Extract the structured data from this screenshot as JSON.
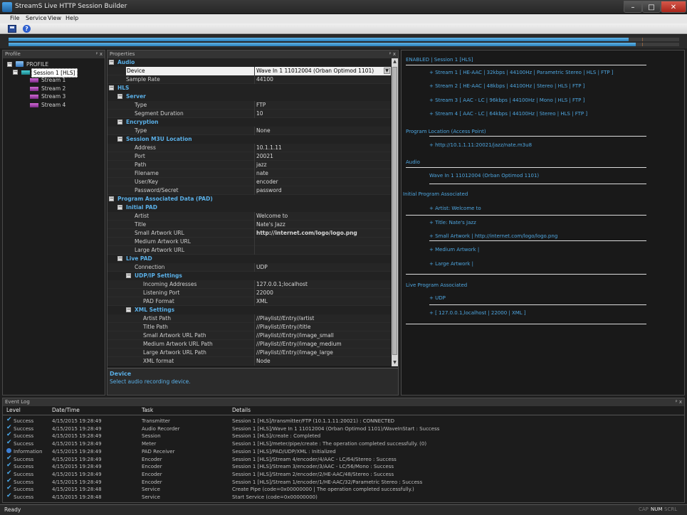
{
  "window": {
    "title": "StreamS Live HTTP Session Builder",
    "min": "–",
    "max": "□",
    "close": "✕"
  },
  "menu": [
    "File",
    "Service",
    "View",
    "Help"
  ],
  "toolbar": {
    "help": "?"
  },
  "meters": {
    "levels": [
      0.925,
      0.935
    ]
  },
  "profile": {
    "header": "Profile",
    "pins": "ᵖ x",
    "root": "PROFILE",
    "session": "Session 1 [HLS]",
    "streams": [
      "Stream 1",
      "Stream 2",
      "Stream 3",
      "Stream 4"
    ]
  },
  "properties": {
    "header": "Properties",
    "pins": "ᵖ x",
    "description_title": "Device",
    "description_text": "Select audio recording device.",
    "rows": [
      {
        "kind": "cat",
        "level": 0,
        "label": "Audio"
      },
      {
        "kind": "item",
        "level": 1,
        "label": "Device",
        "value": "Wave In 1 11012004 (Orban Optimod 1101)",
        "selected": true
      },
      {
        "kind": "item",
        "level": 1,
        "label": "Sample Rate",
        "value": "44100"
      },
      {
        "kind": "cat",
        "level": 0,
        "label": "HLS"
      },
      {
        "kind": "cat",
        "level": 1,
        "label": "Server"
      },
      {
        "kind": "item",
        "level": 2,
        "label": "Type",
        "value": "FTP"
      },
      {
        "kind": "item",
        "level": 2,
        "label": "Segment Duration",
        "value": "10"
      },
      {
        "kind": "cat",
        "level": 1,
        "label": "Encryption"
      },
      {
        "kind": "item",
        "level": 2,
        "label": "Type",
        "value": "None"
      },
      {
        "kind": "cat",
        "level": 1,
        "label": "Session M3U Location"
      },
      {
        "kind": "item",
        "level": 2,
        "label": "Address",
        "value": "10.1.1.11"
      },
      {
        "kind": "item",
        "level": 2,
        "label": "Port",
        "value": "20021"
      },
      {
        "kind": "item",
        "level": 2,
        "label": "Path",
        "value": "jazz"
      },
      {
        "kind": "item",
        "level": 2,
        "label": "Filename",
        "value": "nate"
      },
      {
        "kind": "item",
        "level": 2,
        "label": "User/Key",
        "value": "encoder"
      },
      {
        "kind": "item",
        "level": 2,
        "label": "Password/Secret",
        "value": "password"
      },
      {
        "kind": "cat",
        "level": 0,
        "label": "Program Associated Data (PAD)"
      },
      {
        "kind": "cat",
        "level": 1,
        "label": "Initial PAD"
      },
      {
        "kind": "item",
        "level": 2,
        "label": "Artist",
        "value": "Welcome to"
      },
      {
        "kind": "item",
        "level": 2,
        "label": "Title",
        "value": "Nate's Jazz"
      },
      {
        "kind": "item",
        "level": 2,
        "label": "Small Artwork URL",
        "value": "http://internet.com/logo/logo.png",
        "bold": true
      },
      {
        "kind": "item",
        "level": 2,
        "label": "Medium Artwork URL",
        "value": ""
      },
      {
        "kind": "item",
        "level": 2,
        "label": "Large Artwork URL",
        "value": ""
      },
      {
        "kind": "cat",
        "level": 1,
        "label": "Live PAD"
      },
      {
        "kind": "item",
        "level": 2,
        "label": "Connection",
        "value": "UDP"
      },
      {
        "kind": "cat",
        "level": 2,
        "label": "UDP/IP Settings"
      },
      {
        "kind": "item",
        "level": 3,
        "label": "Incoming Addresses",
        "value": "127.0.0.1;localhost"
      },
      {
        "kind": "item",
        "level": 3,
        "label": "Listening Port",
        "value": "22000"
      },
      {
        "kind": "item",
        "level": 3,
        "label": "PAD Format",
        "value": "XML"
      },
      {
        "kind": "cat",
        "level": 2,
        "label": "XML Settings"
      },
      {
        "kind": "item",
        "level": 3,
        "label": "Artist Path",
        "value": "//Playlist//Entry//artist"
      },
      {
        "kind": "item",
        "level": 3,
        "label": "Title Path",
        "value": "//Playlist//Entry//title"
      },
      {
        "kind": "item",
        "level": 3,
        "label": "Small Artwork URL Path",
        "value": "//Playlist//Entry//image_small"
      },
      {
        "kind": "item",
        "level": 3,
        "label": "Medium Artwork URL Path",
        "value": "//Playlist//Entry//image_medium"
      },
      {
        "kind": "item",
        "level": 3,
        "label": "Large Artwork URL Path",
        "value": "//Playlist//Entry//image_large"
      },
      {
        "kind": "item",
        "level": 3,
        "label": "XML format",
        "value": "Node"
      }
    ]
  },
  "summary": {
    "items": [
      {
        "text": "ENABLED | Session 1 [HLS]",
        "indent": 0
      },
      {
        "text": "+ Stream 1 [ HE-AAC | 32kbps | 44100Hz | Parametric Stereo | HLS | FTP ]",
        "indent": 1
      },
      {
        "text": "+ Stream 2 [ HE-AAC | 48kbps | 44100Hz | Stereo | HLS | FTP ]",
        "indent": 1
      },
      {
        "text": "+ Stream 3 [ AAC - LC | 96kbps | 44100Hz | Mono | HLS | FTP ]",
        "indent": 1
      },
      {
        "text": "+ Stream 4 [ AAC - LC | 64kbps | 44100Hz | Stereo | HLS | FTP ]",
        "indent": 1
      },
      {
        "text": "Program Location (Access Point)",
        "indent": 0
      },
      {
        "text": "+ http://10.1.1.11:20021/jazz/nate.m3u8",
        "indent": 1
      },
      {
        "text": "Audio",
        "indent": 0
      },
      {
        "text": "Wave In 1 11012004 (Orban Optimod 1101)",
        "indent": 1
      },
      {
        "text": "Initial Program Associated",
        "indent": 0
      },
      {
        "text": "+ Artist: Welcome to",
        "indent": 1
      },
      {
        "text": "+ Title: Nate's Jazz",
        "indent": 1
      },
      {
        "text": "+ Small Artwork | http://internet.com/logo/logo.png",
        "indent": 1
      },
      {
        "text": "+ Medium Artwork |",
        "indent": 1
      },
      {
        "text": "+ Large Artwork |",
        "indent": 1
      },
      {
        "text": "Live Program Associated",
        "indent": 0
      },
      {
        "text": "+ UDP",
        "indent": 1
      },
      {
        "text": "+ [ 127.0.0.1,localhost | 22000 | XML ]",
        "indent": 1
      }
    ]
  },
  "eventlog": {
    "header": "Event Log",
    "pins": "ᵖ x",
    "columns": [
      "Level",
      "Date/Time",
      "Task",
      "Details"
    ],
    "rows": [
      {
        "level": "Success",
        "date": "4/15/2015 19:28:49",
        "task": "Transmitter",
        "details": "Session 1 [HLS]/transmitter/FTP (10.1.1.11:20021) : CONNECTED"
      },
      {
        "level": "Success",
        "date": "4/15/2015 19:28:49",
        "task": "Audio Recorder",
        "details": "Session 1 [HLS]/Wave In 1 11012004 (Orban Optimod 1101)/WaveInStart : Success"
      },
      {
        "level": "Success",
        "date": "4/15/2015 19:28:49",
        "task": "Session",
        "details": "Session 1 [HLS]/create : Completed"
      },
      {
        "level": "Success",
        "date": "4/15/2015 19:28:49",
        "task": "Meter",
        "details": "Session 1 [HLS]/meter/pipe/create : The operation completed successfully. (0)"
      },
      {
        "level": "Information",
        "date": "4/15/2015 19:28:49",
        "task": "PAD Receiver",
        "details": "Session 1 [HLS]/PAD/UDP/XML : Initialized"
      },
      {
        "level": "Success",
        "date": "4/15/2015 19:28:49",
        "task": "Encoder",
        "details": "Session 1 [HLS]/Stream 4/encoder/4/AAC - LC/64/Stereo : Success"
      },
      {
        "level": "Success",
        "date": "4/15/2015 19:28:49",
        "task": "Encoder",
        "details": "Session 1 [HLS]/Stream 3/encoder/3/AAC - LC/56/Mono : Success"
      },
      {
        "level": "Success",
        "date": "4/15/2015 19:28:49",
        "task": "Encoder",
        "details": "Session 1 [HLS]/Stream 2/encoder/2/HE-AAC/48/Stereo : Success"
      },
      {
        "level": "Success",
        "date": "4/15/2015 19:28:49",
        "task": "Encoder",
        "details": "Session 1 [HLS]/Stream 1/encoder/1/HE-AAC/32/Parametric Stereo : Success"
      },
      {
        "level": "Success",
        "date": "4/15/2015 19:28:48",
        "task": "Service",
        "details": "Create Pipe (code=0x00000000 | The operation completed successfully.)"
      },
      {
        "level": "Success",
        "date": "4/15/2015 19:28:48",
        "task": "Service",
        "details": "Start Service (code=0x00000000)"
      }
    ]
  },
  "status": {
    "text": "Ready",
    "cap": "CAP",
    "num": "NUM",
    "scrl": "SCRL"
  },
  "colors": {
    "accent": "#5ab0e8",
    "summary_text": "#4ea6e0",
    "meter": "#2b7fba"
  }
}
